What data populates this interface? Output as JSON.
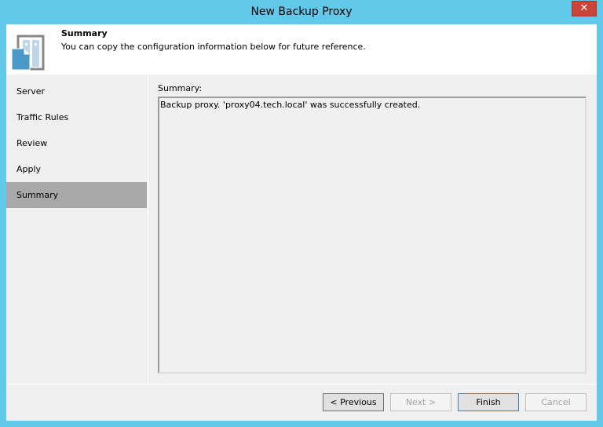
{
  "window": {
    "title": "New Backup Proxy",
    "close_label": "✕"
  },
  "header": {
    "title": "Summary",
    "description": "You can copy the configuration information below for future reference."
  },
  "nav": {
    "items": [
      {
        "label": "Server"
      },
      {
        "label": "Traffic Rules"
      },
      {
        "label": "Review"
      },
      {
        "label": "Apply"
      },
      {
        "label": "Summary"
      }
    ],
    "selected": "Summary"
  },
  "main": {
    "summary_label": "Summary:",
    "summary_text": "Backup proxy. 'proxy04.tech.local' was successfully created."
  },
  "buttons": {
    "previous": "< Previous",
    "next": "Next >",
    "finish": "Finish",
    "cancel": "Cancel"
  }
}
